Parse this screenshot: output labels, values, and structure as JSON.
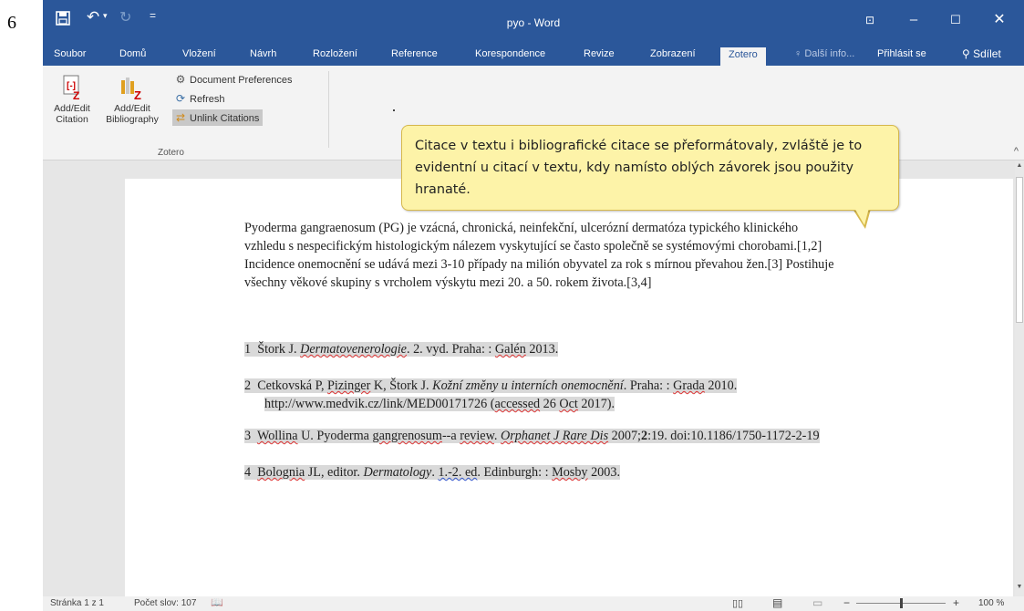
{
  "page_number": "6",
  "app": {
    "title": "pyo - Word"
  },
  "tabs": [
    "Soubor",
    "Domů",
    "Vložení",
    "Návrh",
    "Rozložení",
    "Reference",
    "Korespondence",
    "Revize",
    "Zobrazení",
    "Zotero"
  ],
  "tell_me": "Další info...",
  "sign_in": "Přihlásit se",
  "share": "Sdílet",
  "ribbon": {
    "add_edit_citation": [
      "Add/Edit",
      "Citation"
    ],
    "add_edit_bibliography": [
      "Add/Edit",
      "Bibliography"
    ],
    "document_preferences": "Document Preferences",
    "refresh": "Refresh",
    "unlink_citations": "Unlink Citations",
    "group_label": "Zotero"
  },
  "callout": "Citace v textu i bibliografické citace se přeformátovaly, zvláště je to evidentní u citací v textu, kdy namísto oblých závorek jsou použity hranaté.",
  "document": {
    "paragraph": [
      "Pyoderma gangraenosum (PG) je vzácná, chronická, neinfekční, ulcerózní dermatóza typického klinického",
      "vzhledu s nespecifickým histologickým nálezem vyskytující se často společně se systémovými chorobami.[1,2]",
      "Incidence onemocnění se udává mezi 3-10 případy na milión obyvatel za rok s mírnou převahou žen.[3] Postihuje",
      "všechny věkové skupiny s vrcholem výskytu mezi 20. a 50. rokem života.[3,4]"
    ],
    "refs": {
      "r1": {
        "num": "1",
        "a": "Štork J. ",
        "b": "Dermatovenerologie",
        "c": ". 2. vyd. Praha: : ",
        "d": "Galén",
        "e": " 2013."
      },
      "r2": {
        "num": "2",
        "a": "Cetkovská P, ",
        "b": "Pizinger",
        "c": " K, Štork J. ",
        "d": "Kožní změny u interních onemocnění",
        "e": ". Praha: : ",
        "f": "Grada",
        "g": " 2010.",
        "line2a": "http://www.medvik.cz/link/MED00171726 (",
        "line2b": "accessed",
        "line2c": " 26 ",
        "line2d": "Oct",
        "line2e": " 2017)."
      },
      "r3": {
        "num": "3",
        "a": "Wollina",
        "b": " U. Pyoderma ",
        "c": "gangrenosum",
        "d": "--a ",
        "e": "review",
        "f": ". ",
        "g": "Orphanet J Rare Dis",
        "h": " 2007;",
        "i": "2",
        "j": ":19. doi:10.1186/1750-1172-2-19"
      },
      "r4": {
        "num": "4",
        "a": "Bolognia",
        "b": " JL, editor. ",
        "c": "Dermatology",
        "d": ". ",
        "e": "1.-2. ed",
        "f": ". Edinburgh: : ",
        "g": "Mosby",
        "h": " 2003."
      }
    }
  },
  "status": {
    "page": "Stránka 1 z 1",
    "words": "Počet slov: 107",
    "zoom": "100 %",
    "zoom_level_percent": 100
  },
  "colors": {
    "accent": "#2b579a",
    "callout_bg": "#fdf3a8",
    "highlight": "#d9d9d9"
  }
}
